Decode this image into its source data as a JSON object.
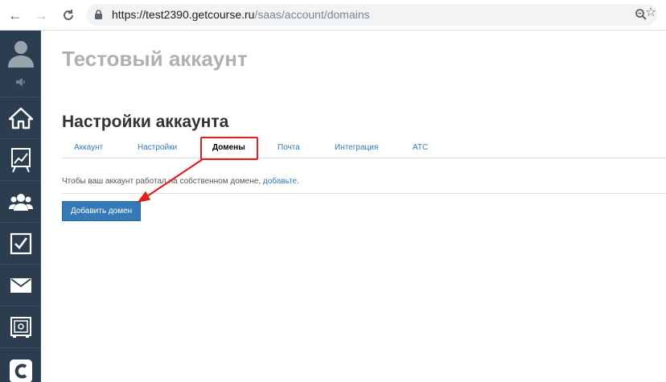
{
  "browser": {
    "url_host": "https://test2390.getcourse.ru",
    "url_path": "/saas/account/domains"
  },
  "main": {
    "account_title": "Тестовый аккаунт",
    "page_title": "Настройки аккаунта",
    "tabs": [
      {
        "label": "Аккаунт"
      },
      {
        "label": "Настройки"
      },
      {
        "label": "Домены"
      },
      {
        "label": "Почта"
      },
      {
        "label": "Интеграция"
      },
      {
        "label": "АТС"
      }
    ],
    "hint_text": "Чтобы ваш аккаунт работал на собственном домене, ",
    "hint_link": "добавьте",
    "hint_end": ".",
    "add_button": "Добавить домен"
  },
  "sidebar": {
    "items": [
      "user-avatar-icon",
      "speaker-icon",
      "home-icon",
      "chart-icon",
      "users-icon",
      "tasks-icon",
      "mail-icon",
      "safe-icon",
      "logo-icon"
    ]
  },
  "colors": {
    "sidebar_bg": "#2b3d4f",
    "link": "#337ab7",
    "button": "#3579b6",
    "highlight": "#e02020"
  }
}
